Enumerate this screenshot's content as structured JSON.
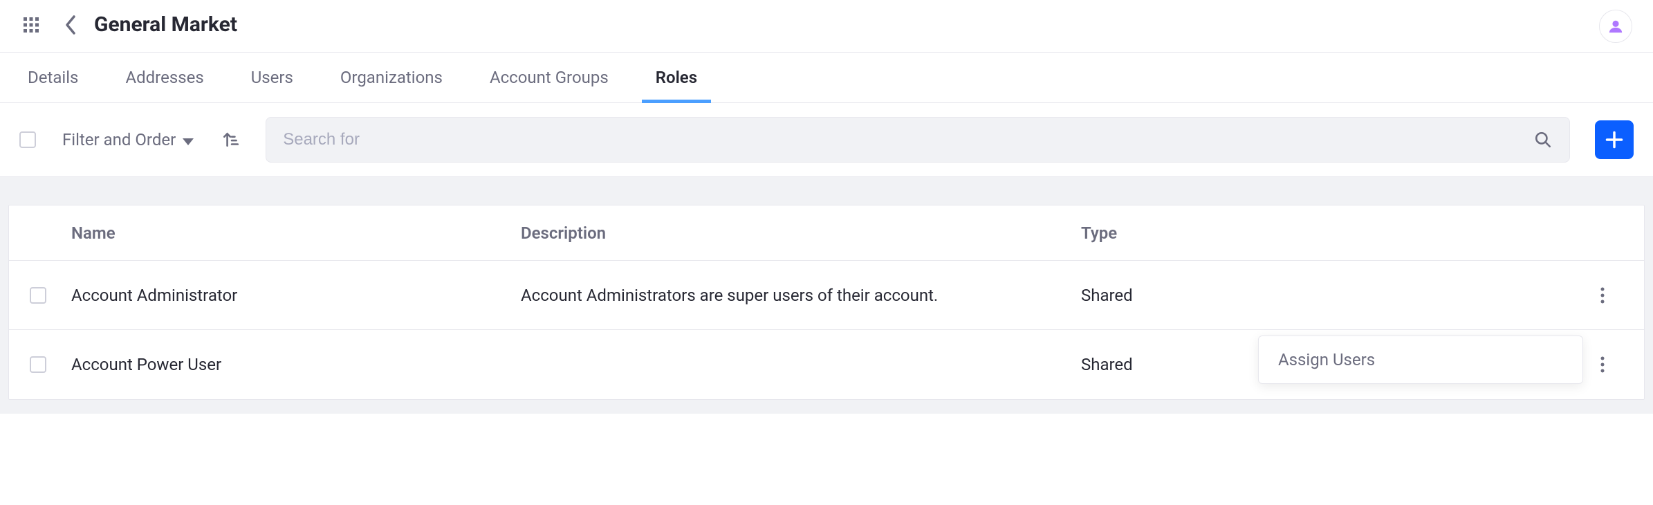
{
  "header": {
    "title": "General Market"
  },
  "tabs": [
    {
      "label": "Details"
    },
    {
      "label": "Addresses"
    },
    {
      "label": "Users"
    },
    {
      "label": "Organizations"
    },
    {
      "label": "Account Groups"
    },
    {
      "label": "Roles"
    }
  ],
  "toolbar": {
    "filter_label": "Filter and Order",
    "search_placeholder": "Search for"
  },
  "table": {
    "columns": {
      "name": "Name",
      "description": "Description",
      "type": "Type"
    },
    "rows": [
      {
        "name": "Account Administrator",
        "description": "Account Administrators are super users of their account.",
        "type": "Shared"
      },
      {
        "name": "Account Power User",
        "description": "",
        "type": "Shared"
      }
    ]
  },
  "menu": {
    "assign_users": "Assign Users"
  }
}
